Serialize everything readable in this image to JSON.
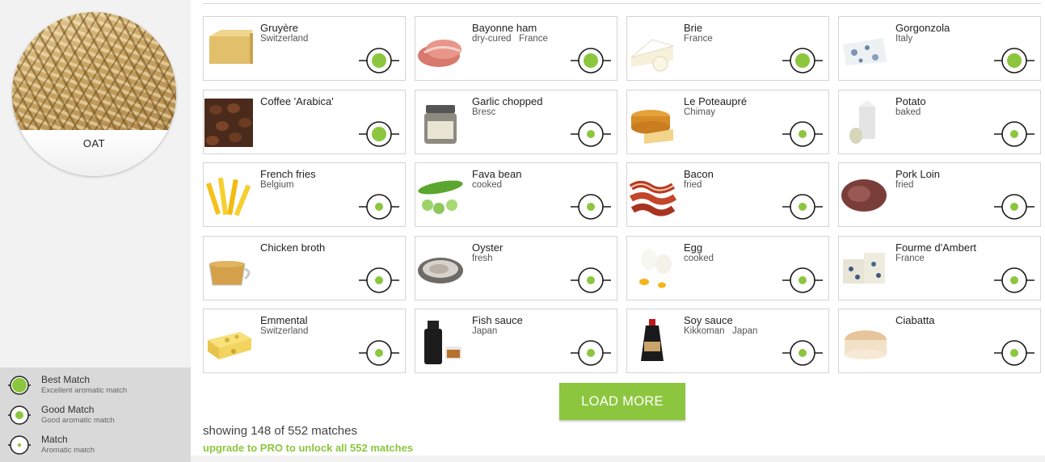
{
  "ingredient": {
    "name": "OAT"
  },
  "legend": [
    {
      "title": "Best Match",
      "subtitle": "Excellent aromatic match",
      "level": "best"
    },
    {
      "title": "Good Match",
      "subtitle": "Good aromatic match",
      "level": "good"
    },
    {
      "title": "Match",
      "subtitle": "Aromatic match",
      "level": "match"
    }
  ],
  "colors": {
    "accent": "#8cc63f",
    "text": "#333333",
    "sidebar": "#f2f2f2",
    "legend_bg": "#d9d9d9"
  },
  "matches": [
    {
      "name": "Gruyère",
      "sub": "Switzerland",
      "level": "best",
      "thumb": "cheese-block"
    },
    {
      "name": "Bayonne ham",
      "sub": "dry-cured   France",
      "level": "best",
      "thumb": "ham-slices"
    },
    {
      "name": "Brie",
      "sub": "France",
      "level": "best",
      "thumb": "brie-wedge"
    },
    {
      "name": "Gorgonzola",
      "sub": "Italy",
      "level": "best",
      "thumb": "blue-cheese"
    },
    {
      "name": "Coffee 'Arabica'",
      "sub": "",
      "level": "best",
      "thumb": "coffee-beans"
    },
    {
      "name": "Garlic chopped",
      "sub": "Bresc",
      "level": "good",
      "thumb": "garlic-jar"
    },
    {
      "name": "Le Poteaupré",
      "sub": "Chimay",
      "level": "good",
      "thumb": "round-cheese"
    },
    {
      "name": "Potato",
      "sub": "baked",
      "level": "good",
      "thumb": "carton"
    },
    {
      "name": "French fries",
      "sub": "Belgium",
      "level": "good",
      "thumb": "fries"
    },
    {
      "name": "Fava bean",
      "sub": "cooked",
      "level": "good",
      "thumb": "fava-beans"
    },
    {
      "name": "Bacon",
      "sub": "fried",
      "level": "good",
      "thumb": "bacon"
    },
    {
      "name": "Pork Loin",
      "sub": "fried",
      "level": "good",
      "thumb": "pork-loin"
    },
    {
      "name": "Chicken broth",
      "sub": "",
      "level": "good",
      "thumb": "broth-cup"
    },
    {
      "name": "Oyster",
      "sub": "fresh",
      "level": "good",
      "thumb": "oyster"
    },
    {
      "name": "Egg",
      "sub": "cooked",
      "level": "good",
      "thumb": "eggs"
    },
    {
      "name": "Fourme d'Ambert",
      "sub": "France",
      "level": "good",
      "thumb": "blue-cheese-round"
    },
    {
      "name": "Emmental",
      "sub": "Switzerland",
      "level": "good",
      "thumb": "emmental"
    },
    {
      "name": "Fish sauce",
      "sub": "Japan",
      "level": "good",
      "thumb": "sauce-bottle"
    },
    {
      "name": "Soy sauce",
      "sub": "Kikkoman   Japan",
      "level": "good",
      "thumb": "soy-bottle"
    },
    {
      "name": "Ciabatta",
      "sub": "",
      "level": "good",
      "thumb": "bread"
    }
  ],
  "load_more_label": "LOAD MORE",
  "showing_text": "showing 148 of 552 matches",
  "upgrade_text": "upgrade to PRO to unlock all 552 matches"
}
